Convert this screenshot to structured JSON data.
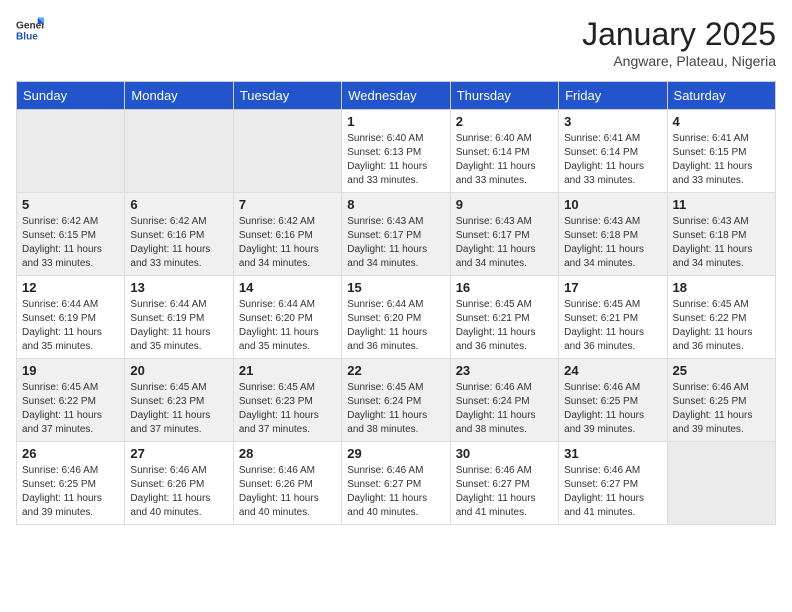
{
  "header": {
    "logo_general": "General",
    "logo_blue": "Blue",
    "month_title": "January 2025",
    "subtitle": "Angware, Plateau, Nigeria"
  },
  "days_of_week": [
    "Sunday",
    "Monday",
    "Tuesday",
    "Wednesday",
    "Thursday",
    "Friday",
    "Saturday"
  ],
  "weeks": [
    [
      {
        "day": "",
        "info": ""
      },
      {
        "day": "",
        "info": ""
      },
      {
        "day": "",
        "info": ""
      },
      {
        "day": "1",
        "info": "Sunrise: 6:40 AM\nSunset: 6:13 PM\nDaylight: 11 hours and 33 minutes."
      },
      {
        "day": "2",
        "info": "Sunrise: 6:40 AM\nSunset: 6:14 PM\nDaylight: 11 hours and 33 minutes."
      },
      {
        "day": "3",
        "info": "Sunrise: 6:41 AM\nSunset: 6:14 PM\nDaylight: 11 hours and 33 minutes."
      },
      {
        "day": "4",
        "info": "Sunrise: 6:41 AM\nSunset: 6:15 PM\nDaylight: 11 hours and 33 minutes."
      }
    ],
    [
      {
        "day": "5",
        "info": "Sunrise: 6:42 AM\nSunset: 6:15 PM\nDaylight: 11 hours and 33 minutes."
      },
      {
        "day": "6",
        "info": "Sunrise: 6:42 AM\nSunset: 6:16 PM\nDaylight: 11 hours and 33 minutes."
      },
      {
        "day": "7",
        "info": "Sunrise: 6:42 AM\nSunset: 6:16 PM\nDaylight: 11 hours and 34 minutes."
      },
      {
        "day": "8",
        "info": "Sunrise: 6:43 AM\nSunset: 6:17 PM\nDaylight: 11 hours and 34 minutes."
      },
      {
        "day": "9",
        "info": "Sunrise: 6:43 AM\nSunset: 6:17 PM\nDaylight: 11 hours and 34 minutes."
      },
      {
        "day": "10",
        "info": "Sunrise: 6:43 AM\nSunset: 6:18 PM\nDaylight: 11 hours and 34 minutes."
      },
      {
        "day": "11",
        "info": "Sunrise: 6:43 AM\nSunset: 6:18 PM\nDaylight: 11 hours and 34 minutes."
      }
    ],
    [
      {
        "day": "12",
        "info": "Sunrise: 6:44 AM\nSunset: 6:19 PM\nDaylight: 11 hours and 35 minutes."
      },
      {
        "day": "13",
        "info": "Sunrise: 6:44 AM\nSunset: 6:19 PM\nDaylight: 11 hours and 35 minutes."
      },
      {
        "day": "14",
        "info": "Sunrise: 6:44 AM\nSunset: 6:20 PM\nDaylight: 11 hours and 35 minutes."
      },
      {
        "day": "15",
        "info": "Sunrise: 6:44 AM\nSunset: 6:20 PM\nDaylight: 11 hours and 36 minutes."
      },
      {
        "day": "16",
        "info": "Sunrise: 6:45 AM\nSunset: 6:21 PM\nDaylight: 11 hours and 36 minutes."
      },
      {
        "day": "17",
        "info": "Sunrise: 6:45 AM\nSunset: 6:21 PM\nDaylight: 11 hours and 36 minutes."
      },
      {
        "day": "18",
        "info": "Sunrise: 6:45 AM\nSunset: 6:22 PM\nDaylight: 11 hours and 36 minutes."
      }
    ],
    [
      {
        "day": "19",
        "info": "Sunrise: 6:45 AM\nSunset: 6:22 PM\nDaylight: 11 hours and 37 minutes."
      },
      {
        "day": "20",
        "info": "Sunrise: 6:45 AM\nSunset: 6:23 PM\nDaylight: 11 hours and 37 minutes."
      },
      {
        "day": "21",
        "info": "Sunrise: 6:45 AM\nSunset: 6:23 PM\nDaylight: 11 hours and 37 minutes."
      },
      {
        "day": "22",
        "info": "Sunrise: 6:45 AM\nSunset: 6:24 PM\nDaylight: 11 hours and 38 minutes."
      },
      {
        "day": "23",
        "info": "Sunrise: 6:46 AM\nSunset: 6:24 PM\nDaylight: 11 hours and 38 minutes."
      },
      {
        "day": "24",
        "info": "Sunrise: 6:46 AM\nSunset: 6:25 PM\nDaylight: 11 hours and 39 minutes."
      },
      {
        "day": "25",
        "info": "Sunrise: 6:46 AM\nSunset: 6:25 PM\nDaylight: 11 hours and 39 minutes."
      }
    ],
    [
      {
        "day": "26",
        "info": "Sunrise: 6:46 AM\nSunset: 6:25 PM\nDaylight: 11 hours and 39 minutes."
      },
      {
        "day": "27",
        "info": "Sunrise: 6:46 AM\nSunset: 6:26 PM\nDaylight: 11 hours and 40 minutes."
      },
      {
        "day": "28",
        "info": "Sunrise: 6:46 AM\nSunset: 6:26 PM\nDaylight: 11 hours and 40 minutes."
      },
      {
        "day": "29",
        "info": "Sunrise: 6:46 AM\nSunset: 6:27 PM\nDaylight: 11 hours and 40 minutes."
      },
      {
        "day": "30",
        "info": "Sunrise: 6:46 AM\nSunset: 6:27 PM\nDaylight: 11 hours and 41 minutes."
      },
      {
        "day": "31",
        "info": "Sunrise: 6:46 AM\nSunset: 6:27 PM\nDaylight: 11 hours and 41 minutes."
      },
      {
        "day": "",
        "info": ""
      }
    ]
  ]
}
